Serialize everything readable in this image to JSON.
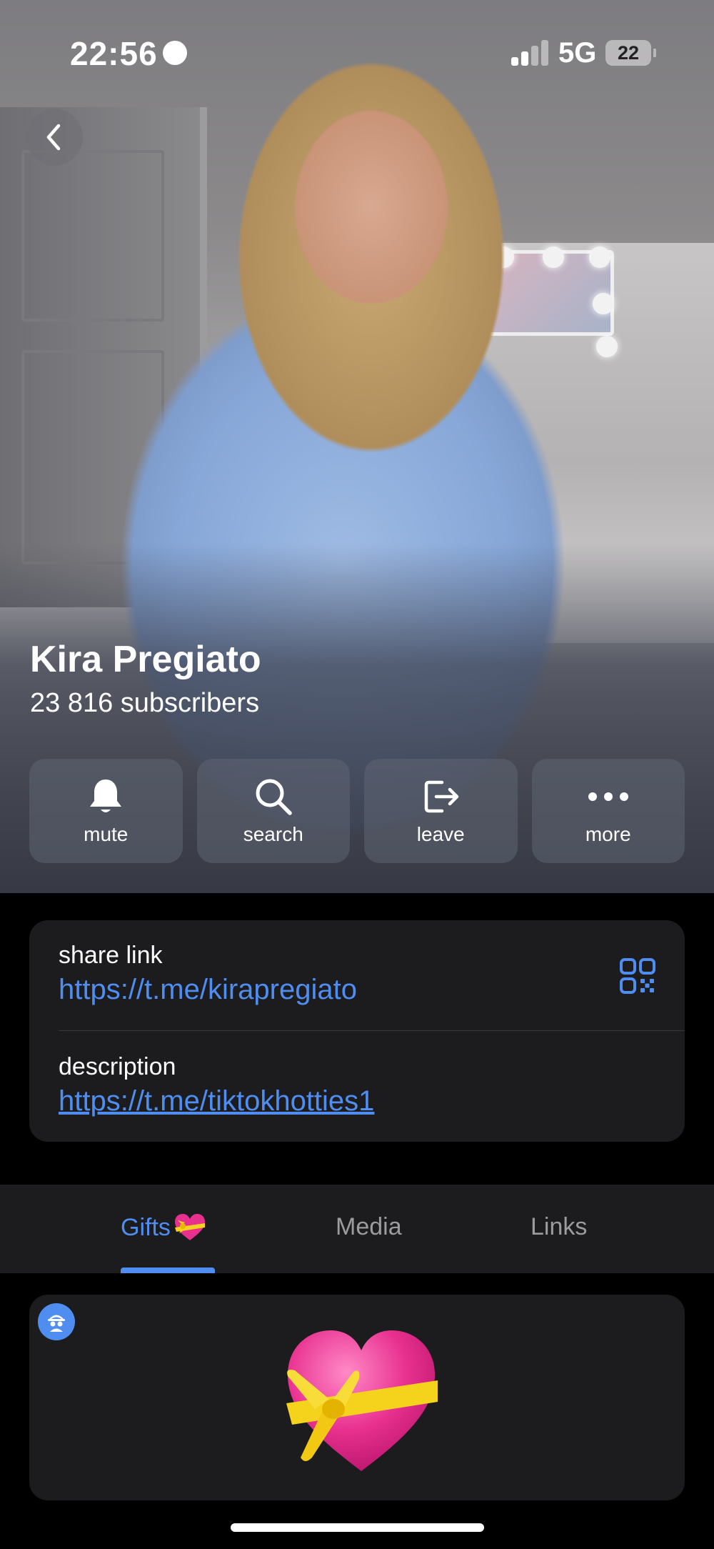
{
  "status_bar": {
    "time": "22:56",
    "network": "5G",
    "battery": "22",
    "signal_bars_active": 2,
    "signal_bars_total": 4
  },
  "header": {
    "back_icon": "chevron-left-icon"
  },
  "channel": {
    "name": "Kira Pregiato",
    "subscribers": "23 816 subscribers"
  },
  "actions": [
    {
      "label": "mute",
      "icon": "bell-icon"
    },
    {
      "label": "search",
      "icon": "search-icon"
    },
    {
      "label": "leave",
      "icon": "leave-icon"
    },
    {
      "label": "more",
      "icon": "more-dots-icon"
    }
  ],
  "info": {
    "share_link_label": "share link",
    "share_link": "https://t.me/kirapregiato",
    "description_label": "description",
    "description": "https://t.me/tiktokhotties1",
    "qr_icon": "qr-code-icon"
  },
  "tabs": [
    {
      "label": "Gifts",
      "icon": "gift-heart-emoji",
      "active": true
    },
    {
      "label": "Media",
      "active": false
    },
    {
      "label": "Links",
      "active": false
    }
  ],
  "gift": {
    "badge_icon": "anonymous-user-icon",
    "emoji": "heart-with-ribbon-icon"
  },
  "colors": {
    "accent": "#4f8ef0",
    "card_bg": "#1c1c1e",
    "inactive_tab": "#9b9ba0",
    "heart_pink": "#e8308f",
    "ribbon_yellow": "#f5d21c"
  }
}
